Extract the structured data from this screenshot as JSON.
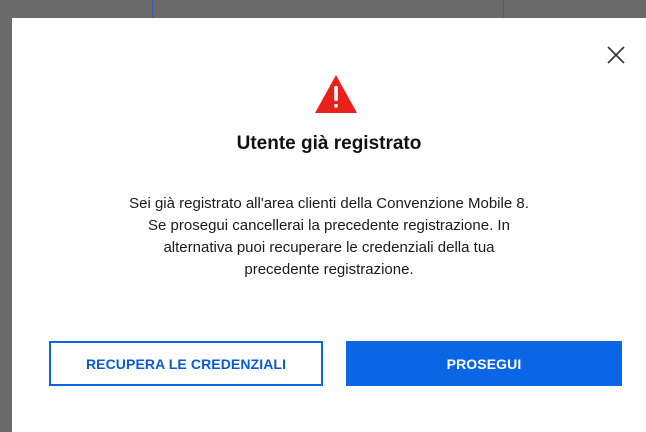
{
  "dialog": {
    "title": "Utente già registrato",
    "message_lines": [
      "Sei già registrato all'area clienti della Convenzione Mobile 8.",
      "Se prosegui cancellerai la precedente registrazione. In",
      "alternativa puoi recuperare le credenziali della tua",
      "precedente registrazione."
    ],
    "icon": "warning-triangle-icon",
    "close_icon": "close-icon",
    "recover_button_label": "RECUPERA LE CREDENZIALI",
    "continue_button_label": "PROSEGUI"
  },
  "colors": {
    "warning_red": "#e8211a",
    "primary_blue": "#0a66e4",
    "overlay_gray": "#6a6a6a"
  }
}
